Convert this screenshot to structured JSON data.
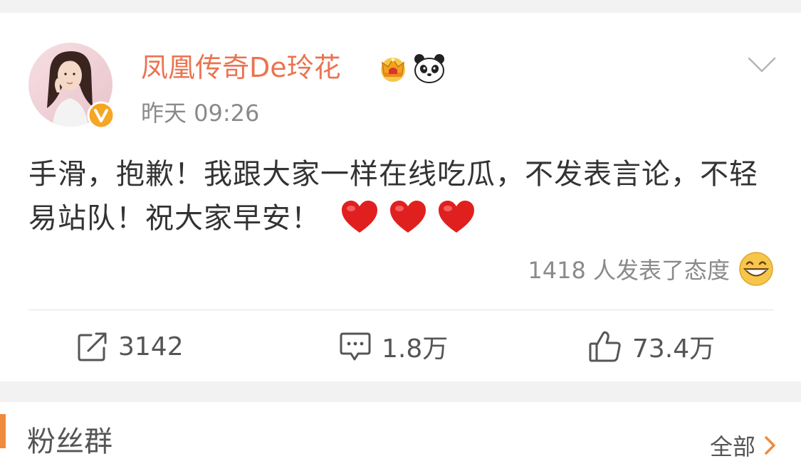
{
  "post": {
    "username": "凤凰传奇De玲花",
    "time": "昨天 09:26",
    "text": "手滑，抱歉！我跟大家一样在线吃瓜，不发表言论，不轻易站队！祝大家早安！",
    "reactions_text": "1418 人发表了态度",
    "actions": {
      "repost_count": "3142",
      "comment_count": "1.8万",
      "like_count": "73.4万"
    },
    "icons": {
      "verified": "verified-v-icon",
      "crown": "crown-icon",
      "panda": "panda-icon",
      "menu": "chevron-down-icon",
      "hearts": "heart-emoji",
      "reaction": "grinning-face-icon",
      "repost": "repost-icon",
      "comment": "comment-icon",
      "like": "thumbs-up-icon"
    },
    "colors": {
      "username": "#eb7350",
      "verified_badge": "#f6a623",
      "heart": "#e0201f",
      "accent_bar": "#f08a3c"
    }
  },
  "fans_section": {
    "title": "粉丝群",
    "all_label": "全部"
  }
}
